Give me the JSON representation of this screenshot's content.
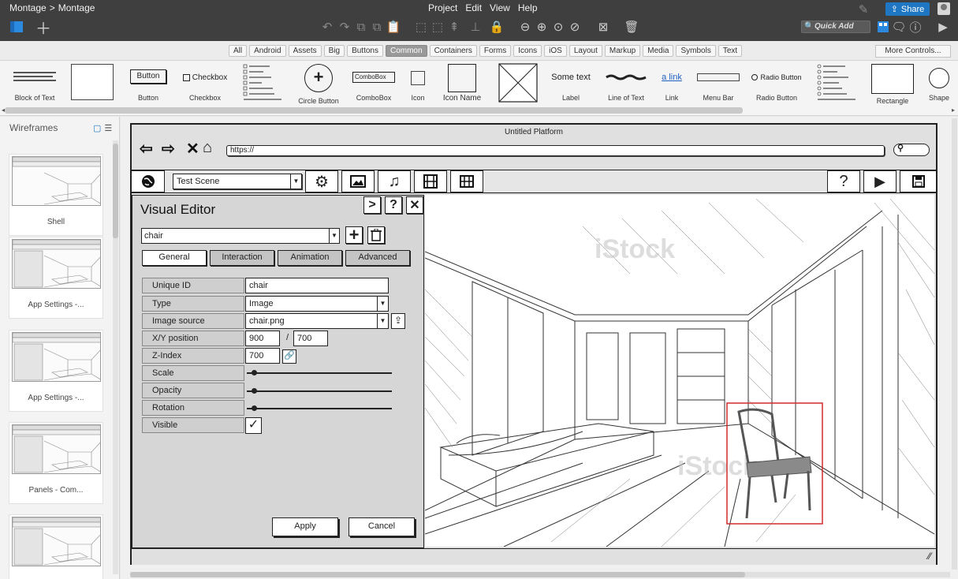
{
  "topbar": {
    "breadcrumb": [
      "Montage",
      "Montage"
    ],
    "breadcrumb_sep": ">",
    "menu": [
      "Project",
      "Edit",
      "View",
      "Help"
    ],
    "share_label": "Share",
    "quick_add": "Quick Add"
  },
  "tabs": [
    "All",
    "Android",
    "Assets",
    "Big",
    "Buttons",
    "Common",
    "Containers",
    "Forms",
    "Icons",
    "iOS",
    "Layout",
    "Markup",
    "Media",
    "Symbols",
    "Text"
  ],
  "active_tab": "Common",
  "more_controls": "More Controls...",
  "library": {
    "block_of_text": "Block of Text",
    "button": "Button",
    "button_preview": "Button",
    "checkbox": "Checkbox",
    "checkbox_preview": "Checkbox",
    "circle_button": "Circle Button",
    "combobox": "ComboBox",
    "combobox_preview": "ComboBox",
    "icon": "Icon",
    "icon_name": "Icon Name",
    "label": "Label",
    "label_preview": "Some text",
    "line_of_text": "Line of Text",
    "link": "Link",
    "link_preview": "a link",
    "menu_bar": "Menu Bar",
    "radio_button": "Radio Button",
    "radio_preview": "Radio Button",
    "rectangle": "Rectangle",
    "shape": "Shape"
  },
  "left_panel": {
    "title": "Wireframes",
    "items": [
      "Shell",
      "App Settings -...",
      "App Settings -...",
      "Panels - Com...",
      ""
    ]
  },
  "mockup": {
    "title": "Untitled Platform",
    "url": "https://",
    "scene": "Test Scene",
    "editor": {
      "title": "Visual Editor",
      "search_value": "chair",
      "tabs": [
        "General",
        "Interaction",
        "Animation",
        "Advanced"
      ],
      "active_tab": "General",
      "props": {
        "unique_id_label": "Unique ID",
        "unique_id": "chair",
        "type_label": "Type",
        "type": "Image",
        "image_source_label": "Image source",
        "image_source": "chair.png",
        "xy_label": "X/Y position",
        "x": "900",
        "y": "700",
        "xy_sep": "/",
        "zindex_label": "Z-Index",
        "zindex": "700",
        "scale_label": "Scale",
        "opacity_label": "Opacity",
        "rotation_label": "Rotation",
        "visible_label": "Visible"
      },
      "apply": "Apply",
      "cancel": "Cancel"
    },
    "watermark": "iStock"
  },
  "colors": {
    "accent": "#1f76c2",
    "selection": "#d22b2b"
  }
}
